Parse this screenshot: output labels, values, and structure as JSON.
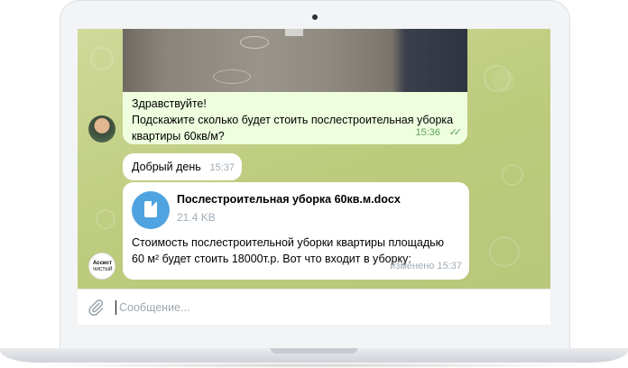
{
  "messages": [
    {
      "id": "m1",
      "direction": "outgoing",
      "text_line1": "Здравствуйте!",
      "text_line2": "Подскажите сколько будет стоить послестроительная уборка",
      "text_line3": "квартиры 60кв/м?",
      "time": "15:36",
      "status": "✓✓"
    },
    {
      "id": "m2",
      "direction": "incoming",
      "text": "Добрый день",
      "time": "15:37"
    },
    {
      "id": "m3",
      "direction": "incoming",
      "file_name": "Послестроительная уборка 60кв.м.docx",
      "file_size": "21.4 KB",
      "text_line1": "Стоимость послестроительной уборки квартиры площадью",
      "text_line2": "60 м² будет стоить 18000т.р. Вот что входит в уборку:",
      "time": "изменено 15:37"
    }
  ],
  "avatar_contact": {
    "text_line1": "Ассист",
    "text_line2": "ЧИСТЫЙ"
  },
  "composer": {
    "placeholder": "Сообщение..."
  },
  "colors": {
    "chat_background": "#c7d48f",
    "outgoing_bubble": "#eefedf",
    "incoming_bubble": "#ffffff",
    "file_icon": "#4fa3e0",
    "read_check": "#5fa45c"
  }
}
